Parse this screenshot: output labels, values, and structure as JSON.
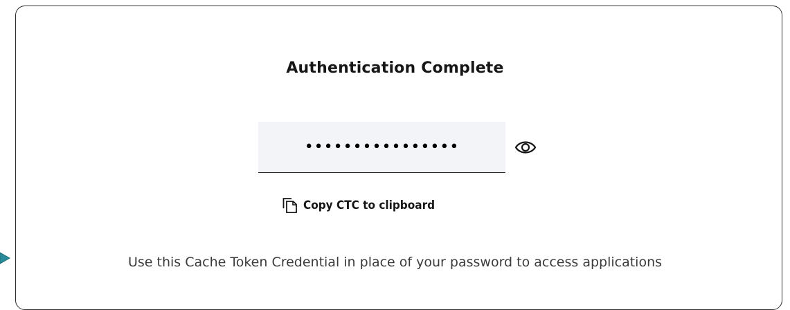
{
  "dialog": {
    "title": "Authentication Complete",
    "token_field": {
      "masked_value": "••••••••••••••••",
      "toggle_icon": "eye-icon"
    },
    "copy_action": {
      "icon": "copy-icon",
      "label": "Copy CTC to clipboard"
    },
    "footer_text": "Use this Cache Token Credential in place of your password to access applications"
  },
  "colors": {
    "field_background": "#f2f4f8",
    "text_primary": "#161616",
    "text_secondary": "#3b3b3b",
    "pointer_accent": "#2a8c9a"
  }
}
